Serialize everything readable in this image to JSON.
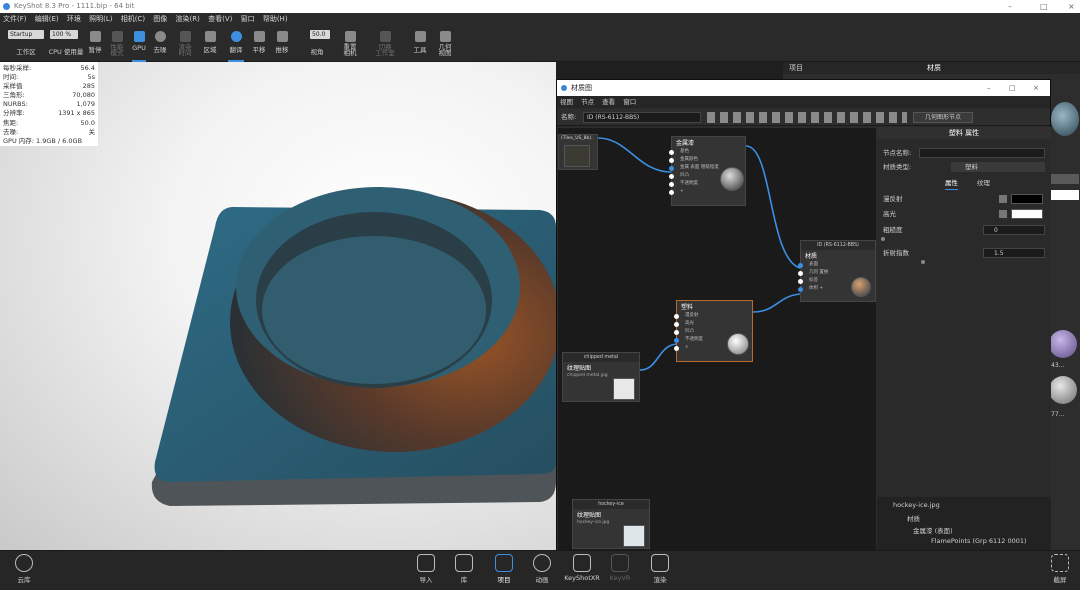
{
  "window": {
    "title": "KeyShot 8.3 Pro  -  1111.bip  -  64 bit"
  },
  "menu": [
    "文件(F)",
    "编辑(E)",
    "环境",
    "照明(L)",
    "相机(C)",
    "图像",
    "渲染(R)",
    "查看(V)",
    "窗口",
    "帮助(H)"
  ],
  "toolbar": {
    "workspace_value": "Startup",
    "workspace_label": "工作区",
    "cpu_value": "100 %",
    "cpu_label": "CPU 使用量",
    "pause_label": "暂停",
    "perf_label": "性能\n模式",
    "gpu_label": "GPU",
    "denoise_label": "去噪",
    "render_label": "渲染\n时间",
    "region_label": "区域",
    "rotate_label": "翻译",
    "pan_label": "平移",
    "push_label": "推移",
    "fov_value": "50.0",
    "fov_label": "视角",
    "reset_label": "重置\n相机",
    "switch_label": "切换\n工作室",
    "tools_label": "工具",
    "geo_label": "几何\n视图"
  },
  "stats": [
    {
      "k": "每秒采样:",
      "v": "56.4"
    },
    {
      "k": "时间:",
      "v": "5s"
    },
    {
      "k": "采样值",
      "v": "285"
    },
    {
      "k": "三角形:",
      "v": "70,080"
    },
    {
      "k": "NURBS:",
      "v": "1,079"
    },
    {
      "k": "分辨率:",
      "v": "1391 x 865"
    },
    {
      "k": "焦距:",
      "v": "50.0"
    },
    {
      "k": "去噪:",
      "v": "关"
    },
    {
      "k": "GPU 内存: 1.9GB / 6.0GB",
      "v": ""
    }
  ],
  "right_panel": {
    "tab_project": "项目",
    "tab_material": "材质",
    "ball1_label": "43...",
    "ball2_label": "77..."
  },
  "mat_window": {
    "title": "材质图",
    "menu": [
      "视图",
      "节点",
      "查看",
      "窗口"
    ],
    "name_label": "名称:",
    "name_value": "ID (RS-6112-BBS)",
    "geo_node_label": "几何图形节点"
  },
  "nodes": {
    "tex1_label": "(Tiles_US_8b)..",
    "metal_title": "金属漆",
    "metal_ports": [
      "基色",
      "金属颜色",
      "金属 表面 粗糙程度",
      "凹凸",
      "不透明度",
      "+"
    ],
    "mat_header": "ID (RS-6112-BBS)",
    "mat_title": "材质",
    "mat_ports": [
      "表面",
      "几何 置换",
      "标签",
      "体积 +"
    ],
    "plastic_title": "塑料",
    "plastic_ports": [
      "漫反射",
      "高光",
      "凹凸",
      "不透明度",
      "+"
    ],
    "chipped_header": "chipped metal",
    "chipped_title": "纹理贴图",
    "chipped_file": "chipped metal.jpg",
    "hockey_header": "hockey-ice",
    "hockey_title": "纹理贴图",
    "hockey_file": "hockey-ice.jpg"
  },
  "props": {
    "header": "塑料 属性",
    "node_name_label": "节点名称:",
    "type_label": "材质类型:",
    "type_value": "塑料",
    "tab_props": "属性",
    "tab_texture": "纹理",
    "diffuse_label": "漫反射",
    "specular_label": "高光",
    "rough_label": "粗糙度",
    "rough_value": "0",
    "ior_label": "折射指数",
    "ior_value": "1.5",
    "tree_items": [
      "hockey-ice.jpg",
      "材质",
      "金属漆 (表面)",
      "FlamePoints (Grp 6112 0001)"
    ]
  },
  "bottom": {
    "cloud_label": "云库",
    "items": [
      "导入",
      "库",
      "项目",
      "动画",
      "KeyShotXR",
      "KeyVR",
      "渲染"
    ],
    "screenshot_label": "截屏"
  },
  "colors": {
    "accent": "#3e8fe0",
    "tile": "#2f6f88",
    "ring": "#8a4a22"
  }
}
